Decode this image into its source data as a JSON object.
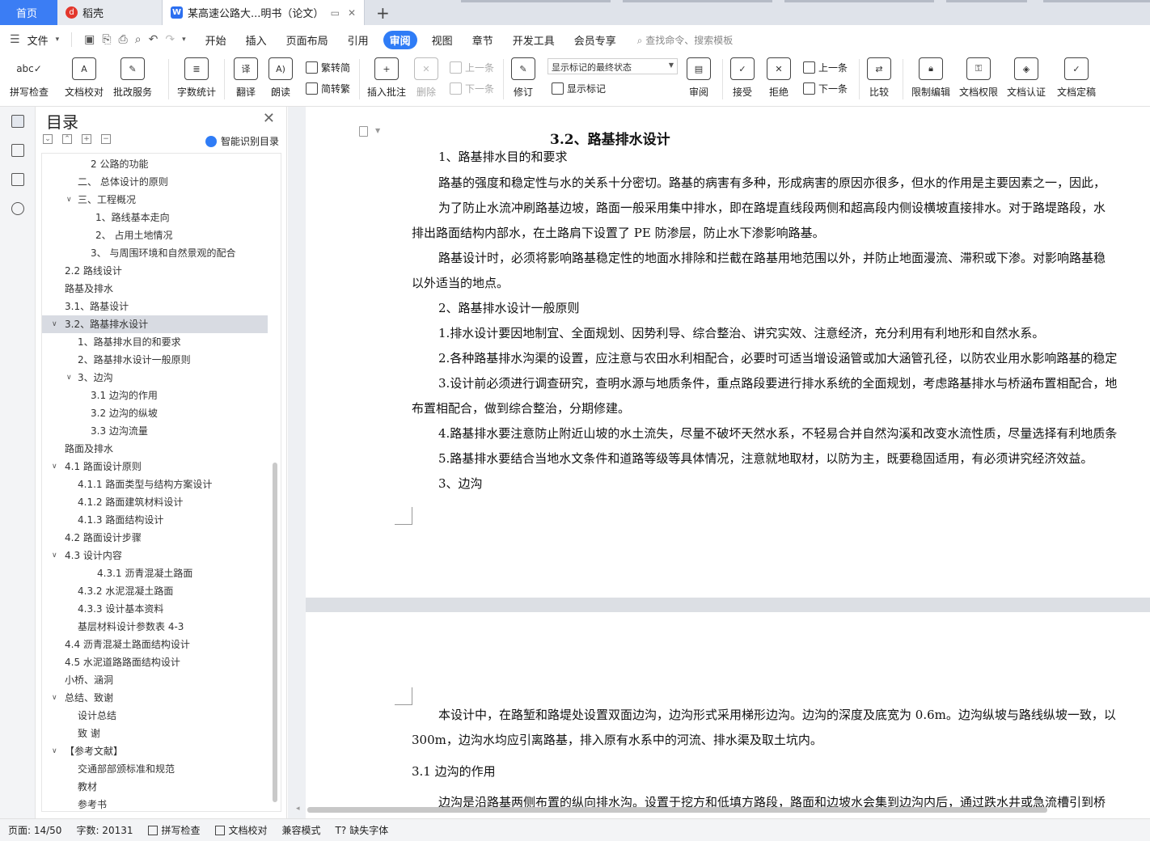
{
  "tabs": {
    "home": "首页",
    "daoke": "稻壳",
    "doc": "某高速公路大...明书（论文）",
    "plus": "+"
  },
  "menu": {
    "file": "文件",
    "items": [
      "开始",
      "插入",
      "页面布局",
      "引用",
      "审阅",
      "视图",
      "章节",
      "开发工具",
      "会员专享"
    ],
    "active": "审阅",
    "search": "查找命令、搜索模板"
  },
  "ribbon": {
    "spell": "拼写检查",
    "proof": "文档校对",
    "annot_service": "批改服务",
    "word_count": "字数统计",
    "translate": "翻译",
    "read": "朗读",
    "trad2simp": "繁转简",
    "simp2trad": "简转繁",
    "insert_comment": "插入批注",
    "delete": "删除",
    "prev": "上一条",
    "next": "下一条",
    "revise": "修订",
    "markup_state": "显示标记的最终状态",
    "show_markup": "显示标记",
    "review": "审阅",
    "accept": "接受",
    "reject": "拒绝",
    "prev2": "上一条",
    "next2": "下一条",
    "compare": "比较",
    "restrict": "限制编辑",
    "permission": "文档权限",
    "certify": "文档认证",
    "finalize": "文档定稿"
  },
  "toc": {
    "title": "目录",
    "smart": "智能识别目录",
    "items": [
      {
        "text": "2 公路的功能"
      },
      {
        "text": "二、  总体设计的原则"
      },
      {
        "text": "三、工程概况"
      },
      {
        "text": "1、路线基本走向"
      },
      {
        "text": "2、   占用土地情况"
      },
      {
        "text": "3、   与周围环境和自然景观的配合"
      },
      {
        "text": "2.2 路线设计"
      },
      {
        "text": "路基及排水"
      },
      {
        "text": "3.1、路基设计"
      },
      {
        "text": "3.2、路基排水设计"
      },
      {
        "text": "1、路基排水目的和要求"
      },
      {
        "text": "2、路基排水设计一般原则"
      },
      {
        "text": "3、边沟"
      },
      {
        "text": "3.1 边沟的作用"
      },
      {
        "text": "3.2 边沟的纵坡"
      },
      {
        "text": "3.3 边沟流量"
      },
      {
        "text": "路面及排水"
      },
      {
        "text": "4.1  路面设计原则"
      },
      {
        "text": "4.1.1 路面类型与结构方案设计"
      },
      {
        "text": "4.1.2 路面建筑材料设计"
      },
      {
        "text": "4.1.3  路面结构设计"
      },
      {
        "text": "4.2  路面设计步骤"
      },
      {
        "text": "4.3 设计内容"
      },
      {
        "text": "4.3.1 沥青混凝土路面"
      },
      {
        "text": "4.3.2  水泥混凝土路面"
      },
      {
        "text": "4.3.3 设计基本资料"
      },
      {
        "text": "基层材料设计参数表 4-3"
      },
      {
        "text": "4.4  沥青混凝土路面结构设计"
      },
      {
        "text": "4.5 水泥道路路面结构设计"
      },
      {
        "text": "小桥、涵洞"
      },
      {
        "text": "总结、致谢"
      },
      {
        "text": "设计总结"
      },
      {
        "text": "致   谢"
      },
      {
        "text": "【参考文献】"
      },
      {
        "text": "交通部部颁标准和规范"
      },
      {
        "text": "教材"
      },
      {
        "text": "参考书"
      }
    ]
  },
  "doc": {
    "heading": "3.2、路基排水设计",
    "lines": [
      "1、路基排水目的和要求",
      "路基的强度和稳定性与水的关系十分密切。路基的病害有多种，形成病害的原因亦很多，但水的作用是主要因素之一，因此，",
      "为了防止水流冲刷路基边坡，路面一般采用集中排水，即在路堤直线段两侧和超高段内侧设横坡直接排水。对于路堤路段，水",
      "排出路面结构内部水，在土路肩下设置了 PE 防渗层，防止水下渗影响路基。",
      "路基设计时，必须将影响路基稳定性的地面水排除和拦截在路基用地范围以外，并防止地面漫流、滞积或下渗。对影响路基稳",
      "以外适当的地点。",
      "2、路基排水设计一般原则",
      "1.排水设计要因地制宜、全面规划、因势利导、综合整治、讲究实效、注意经济，充分利用有利地形和自然水系。",
      "2.各种路基排水沟渠的设置，应注意与农田水利相配合，必要时可适当增设涵管或加大涵管孔径，以防农业用水影响路基的稳定",
      "3.设计前必须进行调查研究，查明水源与地质条件，重点路段要进行排水系统的全面规划，考虑路基排水与桥涵布置相配合，地",
      "布置相配合，做到综合整治，分期修建。",
      "4.路基排水要注意防止附近山坡的水土流失，尽量不破坏天然水系，不轻易合并自然沟溪和改变水流性质，尽量选择有利地质条",
      "5.路基排水要结合当地水文条件和道路等级等具体情况，注意就地取材，以防为主，既要稳固适用，有必须讲究经济效益。",
      "3、边沟"
    ],
    "page2": [
      "本设计中，在路堑和路堤处设置双面边沟，边沟形式采用梯形边沟。边沟的深度及底宽为 0.6m。边沟纵坡与路线纵坡一致，以",
      "300m，边沟水均应引离路基，排入原有水系中的河流、排水渠及取土坑内。",
      "3.1 边沟的作用",
      "边沟是沿路基两侧布置的纵向排水沟。设置于挖方和低填方路段，路面和边坡水会集到边沟内后，通过跌水井或急流槽引到桥"
    ]
  },
  "status": {
    "page": "页面: 14/50",
    "words": "字数: 20131",
    "spell": "拼写检查",
    "proof": "文档校对",
    "compat": "兼容模式",
    "font": "缺失字体"
  }
}
